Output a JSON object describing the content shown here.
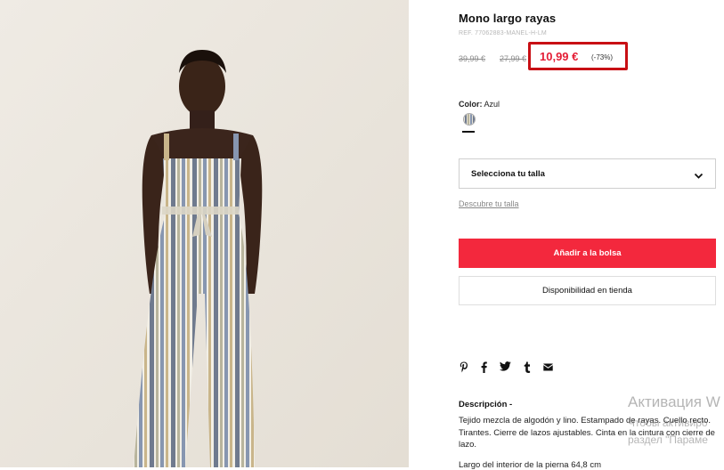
{
  "product": {
    "title": "Mono largo rayas",
    "ref": "REF. 77062883-MANEL-H-LM",
    "old_price_1": "39,99 €",
    "old_price_2": "27,99 €",
    "price": "10,99 €",
    "discount": "(-73%)",
    "color_label": "Color:",
    "color_value": "Azul",
    "size_select_label": "Selecciona tu talla",
    "size_guide_link": "Descubre tu talla",
    "add_to_bag": "Añadir a la bolsa",
    "store_availability": "Disponibilidad en tienda"
  },
  "share_icons": [
    "pinterest-icon",
    "facebook-icon",
    "twitter-icon",
    "tumblr-icon",
    "email-icon"
  ],
  "description": {
    "title": "Descripción  -",
    "text": "Tejido mezcla de algodón y lino. Estampado de rayas. Cuello recto. Tirantes. Cierre de lazos ajustables. Cinta en la cintura con cierre de lazo.",
    "extra": "Largo del interior de la pierna 64,8 cm"
  },
  "watermark": {
    "line1": "Активация W",
    "line2": "Чтобы активиро",
    "line3": "раздел \"Параме"
  },
  "colors": {
    "accent_red": "#f3283d",
    "price_red": "#e41d35",
    "highlight_border": "#c80f14",
    "photo_bg": "#ebe6de"
  }
}
